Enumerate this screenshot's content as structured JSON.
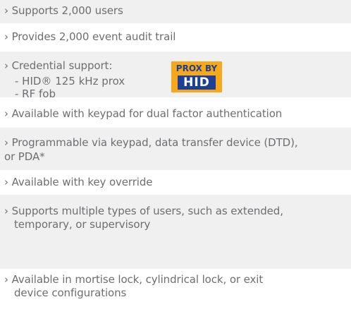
{
  "features": [
    {
      "lines": [
        "› Supports 2,000 users"
      ]
    },
    {
      "lines": [
        "› Provides 2,000 event audit trail"
      ]
    },
    {
      "lines": [
        "› Credential support:"
      ],
      "sub": [
        "- HID® 125 kHz prox",
        "- RF fob"
      ]
    },
    {
      "lines": [
        "› Available with keypad for dual factor authentication"
      ]
    },
    {
      "lines": [
        "› Programmable via keypad, data transfer device (DTD),",
        "or PDA*"
      ]
    },
    {
      "lines": [
        "› Available with key override"
      ]
    },
    {
      "lines": [
        "› Supports multiple types of users, such as extended,",
        "temporary, or supervisory"
      ]
    },
    {
      "lines": [
        "› Available in mortise lock, cylindrical lock, or exit",
        "device configurations"
      ]
    }
  ],
  "logo": {
    "top_text": "PROX BY",
    "brand": "HID"
  },
  "colors": {
    "text": "#6d6e71",
    "band_shade": "#f0f0f1",
    "logo_orange": "#f6a81a",
    "logo_blue": "#1d3f95"
  }
}
